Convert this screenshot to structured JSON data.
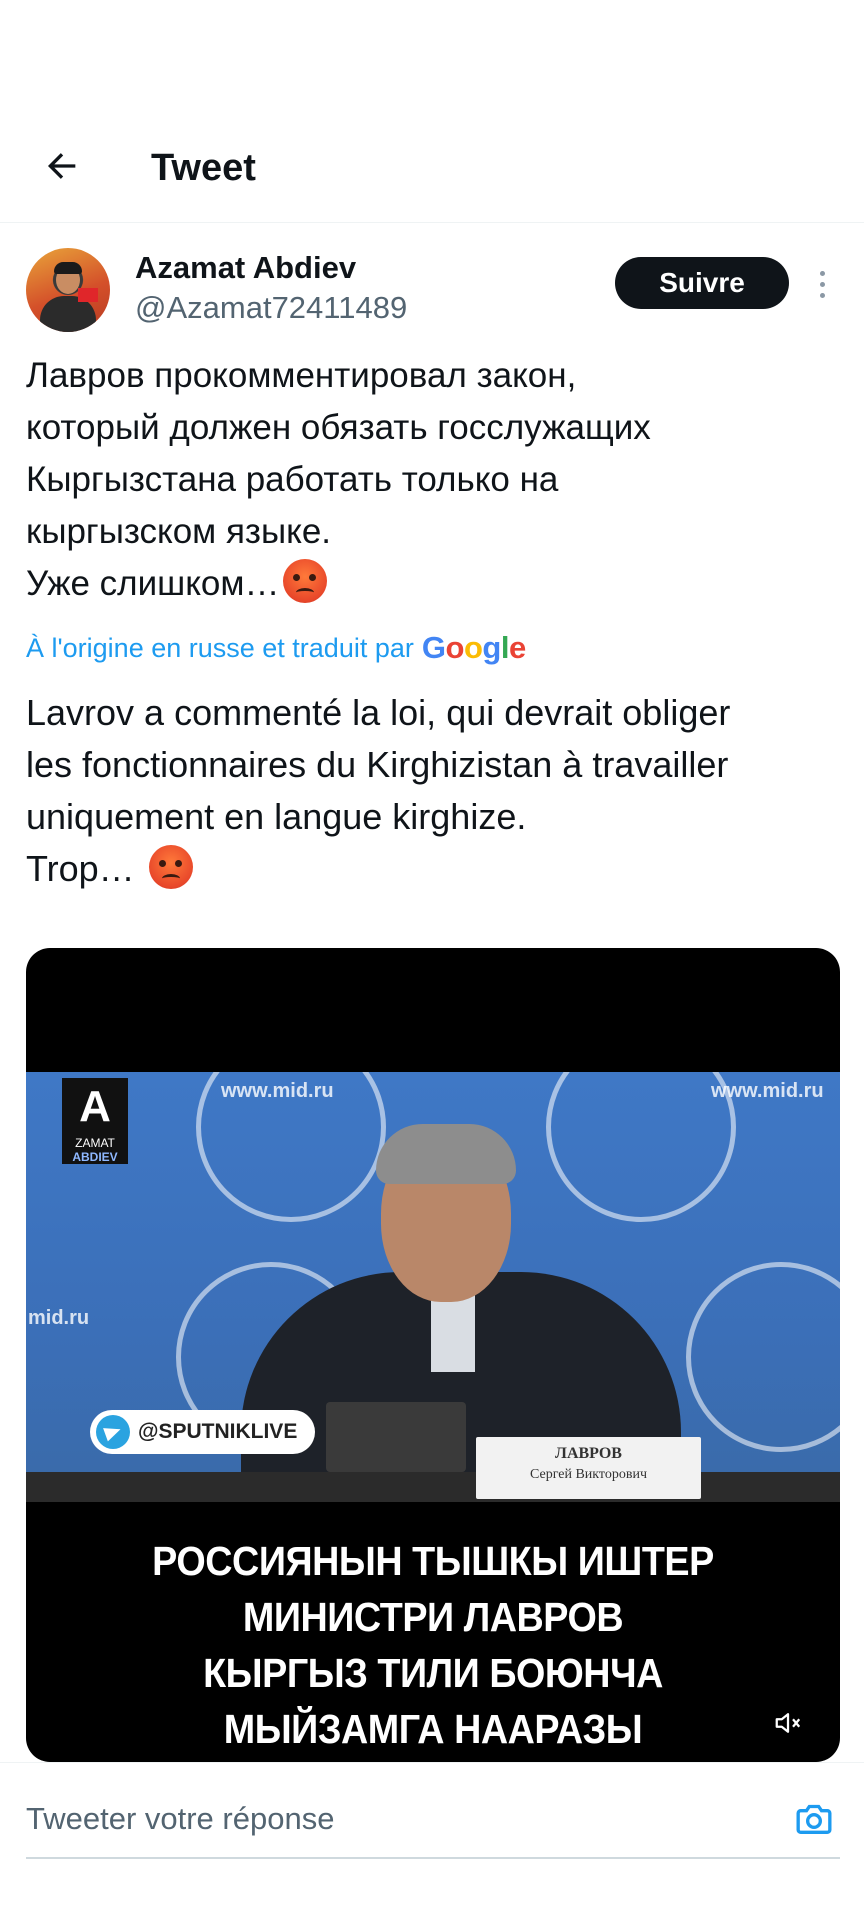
{
  "header": {
    "title": "Tweet"
  },
  "tweet": {
    "author_name": "Azamat Abdiev",
    "author_handle": "@Azamat72411489",
    "follow_label": "Suivre",
    "original_text": "Лавров прокомментировал закон,\nкоторый должен обязать госслужащих\nКыргызстана работать только на\nкыргызском языке.\nУже слишком…",
    "translated_by": "À l'origine en russe et traduit par",
    "translated_by_brand": "Google",
    "translated_text": "Lavrov a commenté la loi, qui devrait obliger\nles fonctionnaires du Kirghizistan à travailler\nuniquement en langue kirghize.\nTrop… "
  },
  "media": {
    "site_watermark": "www.mid.ru",
    "site_watermark_left": "mid.ru",
    "channel_logo_top": "ZAMAT",
    "channel_logo_bottom": "ABDIEV",
    "telegram_tag": "@SPUTNIKLIVE",
    "nameplate_line1": "ЛАВРОВ",
    "nameplate_line2": "Сергей Викторович",
    "caption": "РОССИЯНЫН ТЫШКЫ ИШТЕР\nМИНИСТРИ ЛАВРОВ\nКЫРГЫЗ ТИЛИ БОЮНЧА\nМЫЙЗАМГА НААРАЗЫ"
  },
  "reply": {
    "placeholder": "Tweeter votre réponse"
  },
  "icons": {
    "back": "arrow-left-icon",
    "more": "more-vertical-icon",
    "mute": "muted-speaker-icon",
    "camera": "camera-icon",
    "emoji": "angry-face-emoji"
  },
  "colors": {
    "link": "#1d9bf0",
    "follow_bg": "#0f1419",
    "secondary_text": "#536471"
  }
}
